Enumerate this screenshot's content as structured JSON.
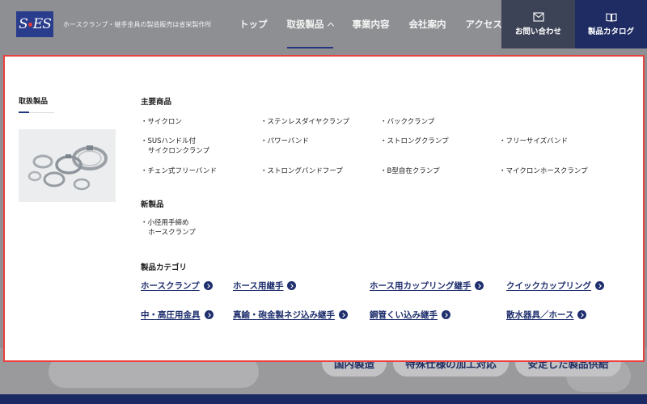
{
  "header": {
    "logo_text": "SES",
    "tagline": "ホースクランプ・継手金具の製造販売は省栄製作所",
    "nav": [
      {
        "label": "トップ"
      },
      {
        "label": "取扱製品"
      },
      {
        "label": "事業内容"
      },
      {
        "label": "会社案内"
      },
      {
        "label": "アクセス"
      }
    ],
    "contact_label": "お問い合わせ",
    "catalog_label": "製品カタログ"
  },
  "mega_menu": {
    "section_title": "取扱製品",
    "main_products": {
      "title": "主要商品",
      "items": [
        "・サイクロン",
        "・ステンレスダイヤクランプ",
        "・バッククランプ",
        "・SUSハンドル付",
        "・パワーバンド",
        "・ストロングクランプ",
        "・フリーサイズバンド",
        "・チェン式フリーバンド",
        "・ストロングバンドフープ",
        "・B型自在クランプ",
        "・マイクロンホースクランプ"
      ],
      "item_4_line2": "サイクロンクランプ"
    },
    "new_products": {
      "title": "新製品",
      "item_line1": "・小径用手締め",
      "item_line2": "ホースクランプ"
    },
    "categories": {
      "title": "製品カテゴリ",
      "links": [
        "ホースクランプ",
        "ホース用継手",
        "ホース用カップリング継手",
        "クイックカップリング",
        "中・高圧用金具",
        "真鍮・砲金製ネジ込み継手",
        "鋼管くい込み継手",
        "散水器具／ホース"
      ]
    }
  },
  "hero_pills": [
    "国内製造",
    "特殊仕様の加工対応",
    "安定した製品供給"
  ],
  "colors": {
    "accent": "#1f2f6e",
    "highlight_border": "#e8413e"
  }
}
